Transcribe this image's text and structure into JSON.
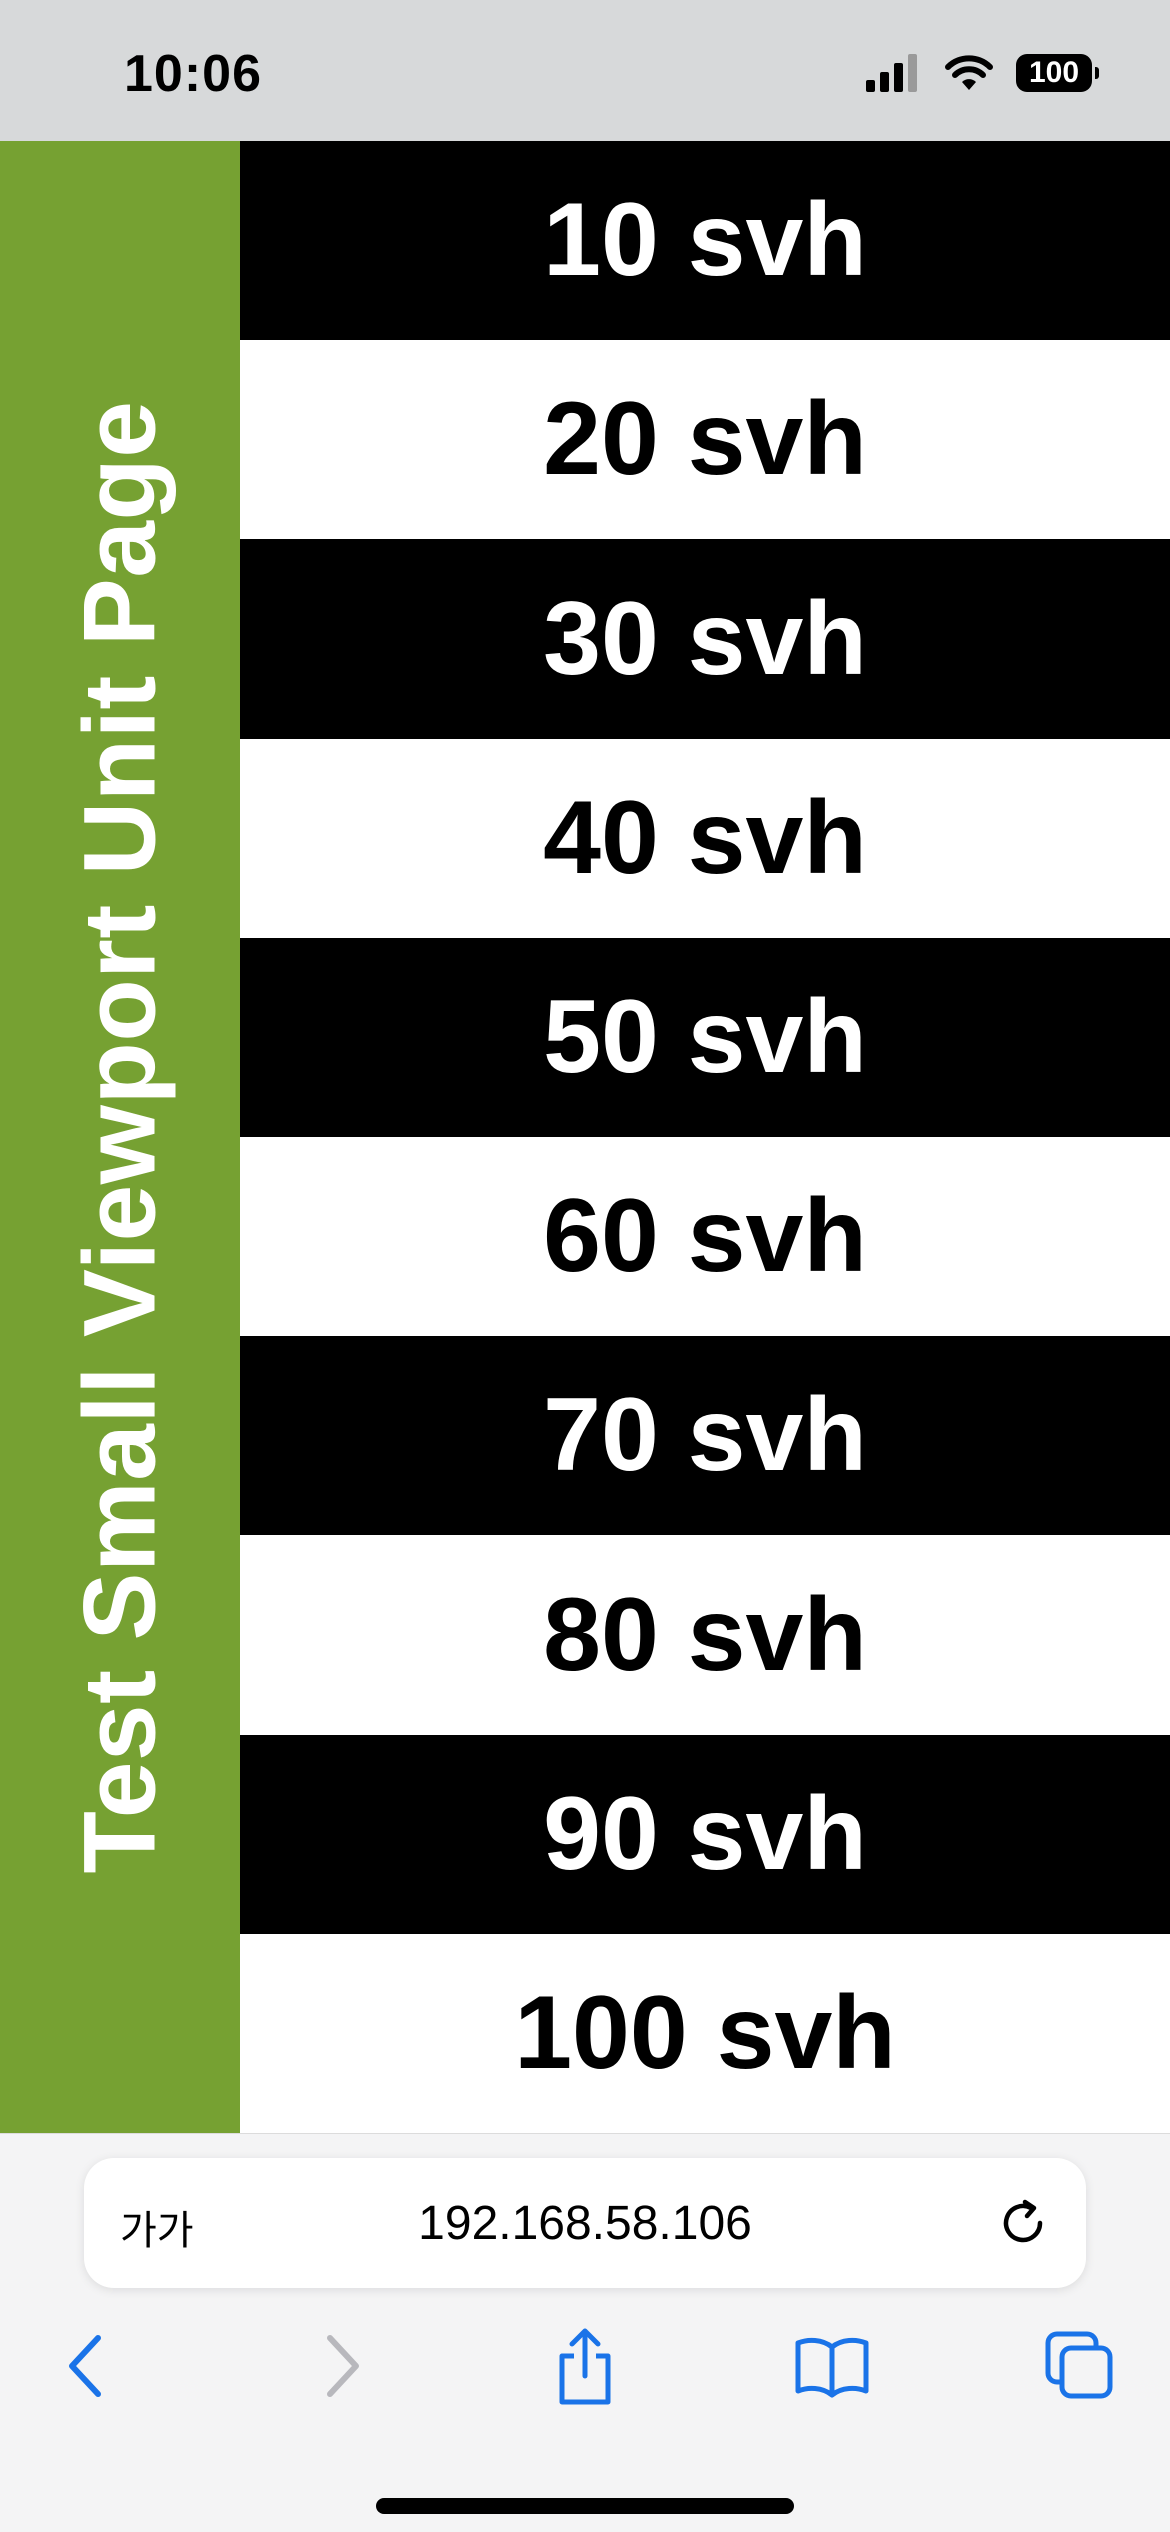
{
  "status_bar": {
    "time": "10:06",
    "battery": "100"
  },
  "page": {
    "side_title": "Test Small Viewport Unit Page",
    "banner_color": "#76a132",
    "bands": [
      {
        "label": "10 svh",
        "theme": "dark"
      },
      {
        "label": "20 svh",
        "theme": "light"
      },
      {
        "label": "30 svh",
        "theme": "dark"
      },
      {
        "label": "40 svh",
        "theme": "light"
      },
      {
        "label": "50 svh",
        "theme": "dark"
      },
      {
        "label": "60 svh",
        "theme": "light"
      },
      {
        "label": "70 svh",
        "theme": "dark"
      },
      {
        "label": "80 svh",
        "theme": "light"
      },
      {
        "label": "90 svh",
        "theme": "dark"
      },
      {
        "label": "100 svh",
        "theme": "light"
      }
    ]
  },
  "address_bar": {
    "text_size_label": "가가",
    "url": "192.168.58.106",
    "reload_icon": "reload-icon"
  },
  "toolbar": {
    "accent_color": "#1a73e8",
    "disabled_color": "#b8b8bd",
    "buttons": [
      "back-icon",
      "forward-icon",
      "share-icon",
      "bookmarks-icon",
      "tabs-icon"
    ]
  }
}
